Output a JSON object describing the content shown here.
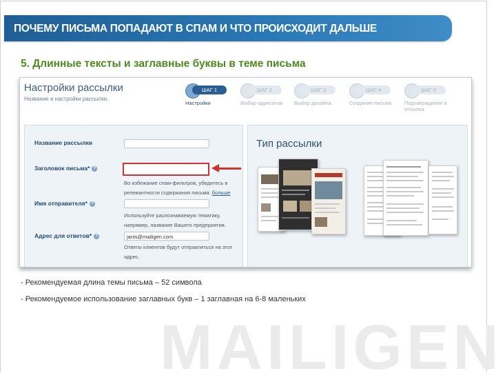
{
  "header": {
    "title": "ПОЧЕМУ ПИСЬМА ПОПАДАЮТ В СПАМ И ЧТО ПРОИСХОДИТ ДАЛЬШЕ"
  },
  "subtitle": "5. Длинные тексты и заглавные буквы в теме письма",
  "screenshot": {
    "title": "Настройки рассылки",
    "subtitle": "Название и настройки рассылки.",
    "steps": [
      {
        "pill": "ШАГ 1",
        "label": "Настройки"
      },
      {
        "pill": "ШАГ 2",
        "label": "Выбор адресатов"
      },
      {
        "pill": "ШАГ 3",
        "label": "Выбор дизайна"
      },
      {
        "pill": "ШАГ 4",
        "label": "Создание письма"
      },
      {
        "pill": "ШАГ 5",
        "label": "Подтверждение и отсылка"
      }
    ],
    "form": {
      "name_label": "Название рассылки",
      "subject_label": "Заголовок письма*",
      "subject_hint": "Во избежание спам-фильтров, убедитесь в релевантности содержания письма.",
      "subject_hint_link": "больше",
      "sender_label": "Имя отправителя*",
      "sender_hint": "Используйте распознаваемую тематику, например, название Вашего предприятия.",
      "reply_label": "Адрес для ответов*",
      "reply_value": "janis@mailigen.com",
      "reply_hint": "Ответы клиентов будут отправляться на этот адрес."
    },
    "type_title": "Тип рассылки"
  },
  "bullets": [
    "- Рекомендуемая длина темы письма  – 52 символа",
    "- Рекомендуемое использование заглавных букв – 1 заглавная на 6-8 маленьких"
  ],
  "watermark": "MAILIGEN",
  "colors": {
    "header_blue": "#2a79b5",
    "subtitle_green": "#4b8b1e",
    "highlight_red": "#d0312c"
  }
}
